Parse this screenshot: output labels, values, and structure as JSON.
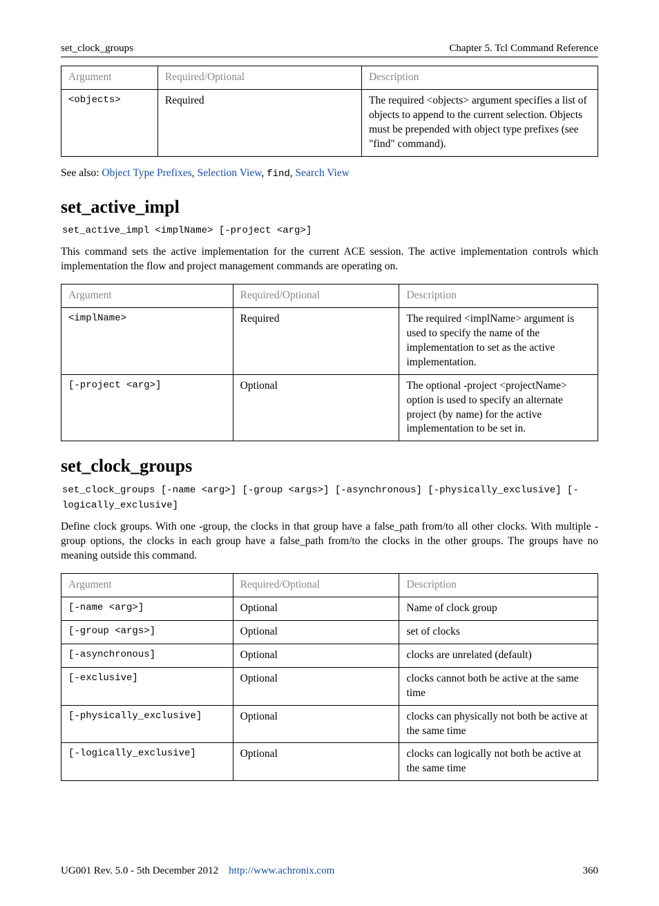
{
  "header": {
    "left": "set_clock_groups",
    "right": "Chapter 5. Tcl Command Reference"
  },
  "table1": {
    "cols": [
      "Argument",
      "Required/Optional",
      "Description"
    ],
    "rows": [
      {
        "arg_pre": "",
        "arg_mid": "objects",
        "arg_post": "",
        "req": "Required",
        "desc_pre": "The required ",
        "desc_token": "objects",
        "desc_post": " argument specifies a list of objects to append to the current selection. Objects must be prepended with object type prefixes (see \"find\" command)."
      }
    ]
  },
  "seealso": {
    "label": "See also: ",
    "links": [
      "Object Type Prefixes",
      "Selection View",
      "find",
      "Search View"
    ]
  },
  "cmd1": {
    "title": "set_active_impl",
    "usage": "set_active_impl <implName> [-project <arg>]",
    "desc": "This command sets the active implementation for the current ACE session. The active implementation controls which implementation the flow and project management commands are operating on.",
    "cols": [
      "Argument",
      "Required/Optional",
      "Description"
    ],
    "rows": [
      {
        "arg": "<implName>",
        "req": "Required",
        "desc_pre": "The required ",
        "desc_token": "implName",
        "desc_post": " argument is used to specify the name of the implementation to set as the active implementation."
      },
      {
        "arg": "[-project <arg>]",
        "req": "Optional",
        "desc_pre": "The optional -project ",
        "desc_token": "projectName",
        "desc_post": " option is used to specify an alternate project (by name) for the active implementation to be set in."
      }
    ]
  },
  "cmd2": {
    "title": "set_clock_groups",
    "usage": "set_clock_groups [-name <arg>] [-group <args>] [-asynchronous] [-physically_exclusive] [-logically_exclusive]",
    "desc": "Define clock groups. With one -group, the clocks in that group have a false_path from/to all other clocks. With multiple -group options, the clocks in each group have a false_path from/to the clocks in the other groups. The groups have no meaning outside this command.",
    "cols": [
      "Argument",
      "Required/Optional",
      "Description"
    ],
    "rows": [
      {
        "arg": "[-name <arg>]",
        "req": "Optional",
        "desc": "Name of clock group"
      },
      {
        "arg": "[-group <args>]",
        "req": "Optional",
        "desc": "set of clocks"
      },
      {
        "arg": "[-asynchronous]",
        "req": "Optional",
        "desc": "clocks are unrelated (default)"
      },
      {
        "arg": "[-exclusive]",
        "req": "Optional",
        "desc": "clocks cannot both be active at the same time"
      },
      {
        "arg": "[-physically_exclusive]",
        "req": "Optional",
        "desc": "clocks can physically not both be active at the same time"
      },
      {
        "arg": "[-logically_exclusive]",
        "req": "Optional",
        "desc": "clocks can logically not both be active at the same time"
      }
    ]
  },
  "footer": {
    "left": "UG001 Rev. 5.0 - 5th December 2012",
    "url": "http://www.achronix.com",
    "page": "360"
  }
}
